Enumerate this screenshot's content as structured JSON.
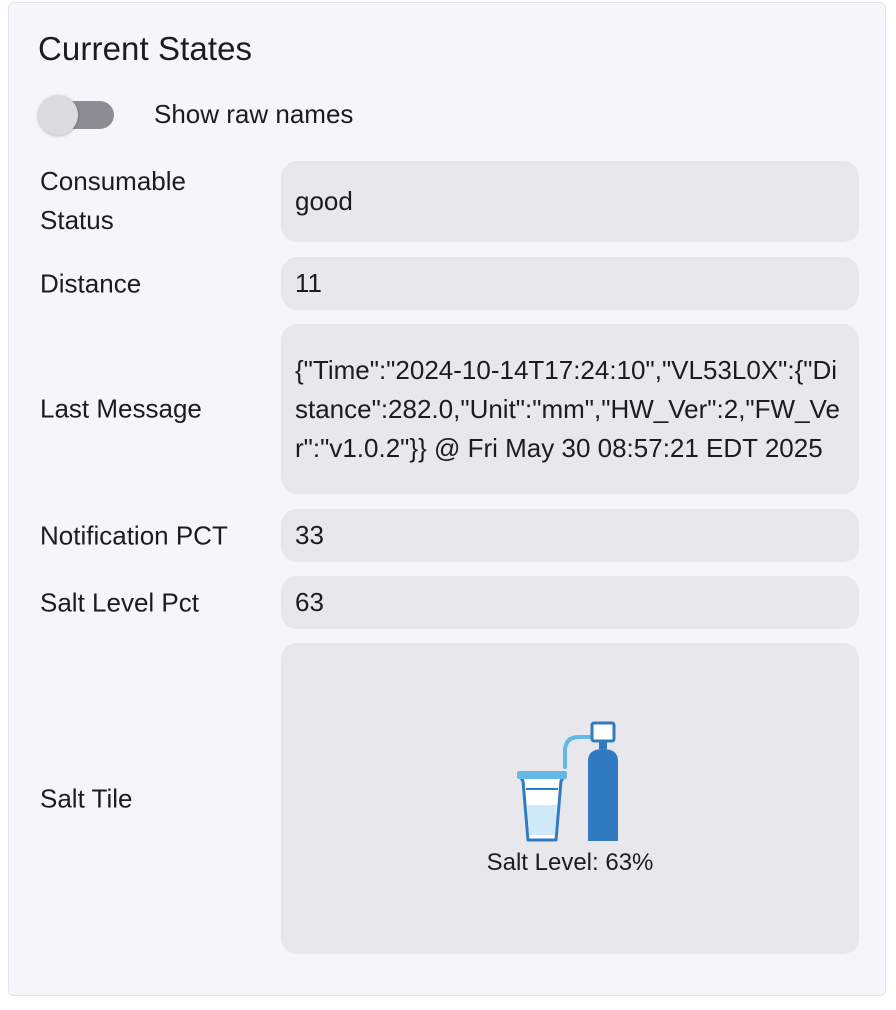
{
  "card": {
    "title": "Current States",
    "toggle": {
      "label": "Show raw names",
      "checked": false
    }
  },
  "states": [
    {
      "label": "Consumable Status",
      "value": "good"
    },
    {
      "label": "Distance",
      "value": "11"
    },
    {
      "label": "Last Message",
      "value": "{\"Time\":\"2024-10-14T17:24:10\",\"VL53L0X\":{\"Distance\":282.0,\"Unit\":\"mm\",\"HW_Ver\":2,\"FW_Ver\":\"v1.0.2\"}} @ Fri May 30 08:57:21 EDT 2025"
    },
    {
      "label": "Notification PCT",
      "value": "33"
    },
    {
      "label": "Salt Level Pct",
      "value": "63"
    },
    {
      "label": "Salt Tile",
      "caption": "Salt Level: 63%",
      "icon": "water-softener-icon"
    }
  ],
  "colors": {
    "card_background": "#f6f5fa",
    "value_background": "#e8e7ec",
    "icon_blue": "#2f7ac0",
    "icon_light_blue": "#64b8e6"
  }
}
